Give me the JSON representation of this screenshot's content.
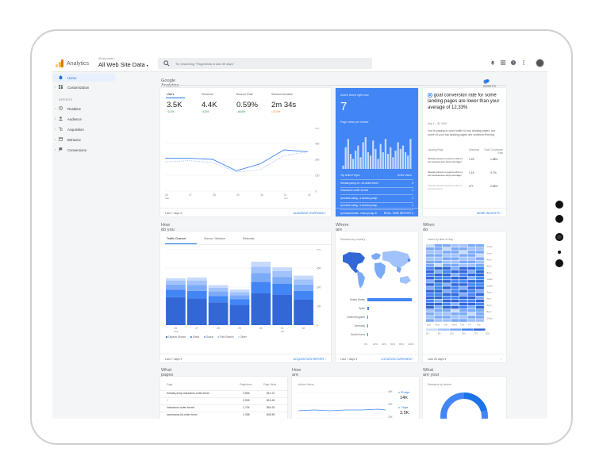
{
  "app": {
    "name": "Analytics",
    "account_small": "All accounts >",
    "property": "All Web Site Data"
  },
  "search": {
    "placeholder": "Try searching \"Pageviews in last 30 days\""
  },
  "sidebar": {
    "items": [
      {
        "label": "Home",
        "icon": "home-icon"
      },
      {
        "label": "Customization",
        "icon": "dashboard-icon"
      },
      {
        "label": "Realtime",
        "icon": "clock-icon"
      },
      {
        "label": "Audience",
        "icon": "person-icon"
      },
      {
        "label": "Acquisition",
        "icon": "acquisition-icon"
      },
      {
        "label": "Behavior",
        "icon": "behavior-icon"
      },
      {
        "label": "Conversions",
        "icon": "flag-icon"
      }
    ],
    "reports_label": "REPORTS"
  },
  "home": {
    "title": "Google Analytics Home",
    "insights": "INSIGHTS"
  },
  "metrics": [
    {
      "label": "Users",
      "value": "3.5K",
      "change": "↑3.1%"
    },
    {
      "label": "Sessions",
      "value": "4.4K",
      "change": "↑4.3%"
    },
    {
      "label": "Bounce Rate",
      "value": "0.59%",
      "change": "↓46.6%"
    },
    {
      "label": "Session Duration",
      "value": "2m 34s",
      "change": "↓17.0%"
    }
  ],
  "overview": {
    "range": "Last 7 days ▾",
    "link": "AUDIENCE OVERVIEW",
    "yticks": [
      "600",
      "450",
      "300",
      "150",
      "0"
    ],
    "xticks": [
      "26",
      "27",
      "28",
      "29",
      "30",
      "01",
      "02"
    ],
    "xsub": [
      "Sep",
      "",
      "",
      "",
      "",
      "Oct",
      ""
    ]
  },
  "realtime": {
    "title": "Active Users right now",
    "value": "7",
    "sub": "Page views per minute",
    "bars": [
      0.1,
      0.65,
      0.9,
      0.45,
      0.3,
      0.55,
      0.7,
      0.35,
      0.8,
      0.95,
      0.5,
      0.4,
      0.85,
      0.6,
      0.3,
      0.75,
      0.5,
      0.9,
      0.45,
      0.65,
      0.35,
      0.55,
      0.8,
      0.6,
      0.7,
      0.5,
      0.4,
      0.9
    ],
    "head_l": "Top Active Pages",
    "head_r": "Active Users",
    "rows": [
      {
        "p": "/breast-pump-in...ce-order-form/",
        "u": "2"
      },
      {
        "p": "/insurance-order-forms/",
        "u": "1"
      },
      {
        "p": "/product-categ...s-breast-pump",
        "u": "1"
      },
      {
        "p": "/product-categ...s-breast-pump",
        "u": "1"
      },
      {
        "p": "/product/medel...reast-pump-2/",
        "u": "1"
      }
    ],
    "link": "REAL-TIME REPORT"
  },
  "insight": {
    "headline": "goal conversion rate for some landing pages are lower than your average of 12.33%",
    "date": "Sep 1 – 30, 2019",
    "body": "You're paying to drive traffic to buy landing pages, but some of your top landing pages are underperforming.",
    "cols": [
      "Landing Page",
      "Sessions",
      "Goal Conversion Rate"
    ],
    "rows": [
      {
        "p": "/breast-pumps-to-need-to-ship-in-our-local-area-to-ship-coverage/",
        "s": "1.2K",
        "r": "1.88%"
      },
      {
        "p": "/breast-pumps-to-need-to-ship-in-our-local-area-to-ship-coverage/",
        "s": "1.1K",
        "r": "3.7%"
      },
      {
        "p": "/breast-pumps-to-need-to-ship-in-our-local-area",
        "s": "277",
        "r": "2.55%"
      }
    ],
    "link": "MORE INSIGHTS"
  },
  "sections": {
    "acquire": "How do you acquire users?",
    "where": "Where are your users?",
    "when": "When do your users visit?",
    "pages": "What pages do your users visit?",
    "trending": "How are your active users trending over time?",
    "devices": "What are your top devices?"
  },
  "acquisition": {
    "tabs": [
      "Traffic Channel",
      "Source / Medium",
      "Referrals"
    ],
    "yticks": [
      "600",
      "450",
      "300",
      "150",
      "0"
    ],
    "cats": [
      "26",
      "27",
      "28",
      "29",
      "30",
      "01",
      "02"
    ],
    "catsub": [
      "Sep",
      "",
      "",
      "",
      "",
      "Oct",
      ""
    ],
    "series": [
      {
        "name": "Organic Search",
        "color": "#3367d6",
        "values": [
          220,
          210,
          180,
          160,
          250,
          240,
          200
        ]
      },
      {
        "name": "Direct",
        "color": "#4285f4",
        "values": [
          60,
          60,
          50,
          45,
          90,
          85,
          70
        ]
      },
      {
        "name": "Social",
        "color": "#7baaf7",
        "values": [
          40,
          45,
          35,
          30,
          70,
          55,
          50
        ]
      },
      {
        "name": "Paid Search",
        "color": "#a1c2fa",
        "values": [
          30,
          35,
          30,
          25,
          50,
          45,
          40
        ]
      },
      {
        "name": "Other",
        "color": "#c6dafc",
        "values": [
          20,
          25,
          20,
          20,
          40,
          30,
          30
        ]
      }
    ],
    "ymax": 600,
    "range": "Last 7 days ▾",
    "link": "ACQUISITION REPORT"
  },
  "geo": {
    "title": "Sessions by country",
    "countries": [
      {
        "name": "United States",
        "v": 1
      },
      {
        "name": "Spain",
        "v": 0.03
      },
      {
        "name": "United Kingdom",
        "v": 0.025
      },
      {
        "name": "Germany",
        "v": 0.02
      },
      {
        "name": "South Korea",
        "v": 0.015
      }
    ],
    "xticks": [
      "0%",
      "20%",
      "40%",
      "60%",
      "80%",
      "100%"
    ],
    "range": "Last 7 days ▾",
    "link": "LOCATION OVERVIEW"
  },
  "heat": {
    "title": "Users by time of day",
    "hours": [
      "12am",
      "2am",
      "4am",
      "6am",
      "8am",
      "10am",
      "12pm",
      "2pm",
      "4pm",
      "6pm",
      "8pm",
      "10pm"
    ],
    "days": [
      "Sun",
      "Mon",
      "Tue",
      "Wed",
      "Thu",
      "Fri",
      "Sat"
    ],
    "legend": [
      "50",
      "80",
      "110",
      "140",
      "170",
      "200"
    ],
    "range": "Last 28 days ▾"
  },
  "pages": {
    "cols": [
      "Page",
      "Pageviews",
      "Page Value"
    ],
    "rows": [
      {
        "p": "/breast-pump-insurance-order-form/",
        "v": "3,505",
        "x": "$14.37"
      },
      {
        "p": "/",
        "v": "2,539",
        "x": "$15.45"
      },
      {
        "p": "/insurance-order-forms/",
        "v": "1,704",
        "x": "$54.33"
      },
      {
        "p": "/accessory-kit-order-form/",
        "v": "1,338",
        "x": "$45.50"
      }
    ]
  },
  "active": {
    "title": "Active Users",
    "legend": [
      {
        "l": "30 days",
        "v": "14K"
      },
      {
        "l": "7 days",
        "v": "3.5K"
      }
    ],
    "yticks": [
      "45K",
      "30K",
      "15K"
    ]
  },
  "devices": {
    "title": "Sessions by device"
  },
  "colors": {
    "primary": "#1a73e8",
    "realtime": "#4285f4"
  }
}
